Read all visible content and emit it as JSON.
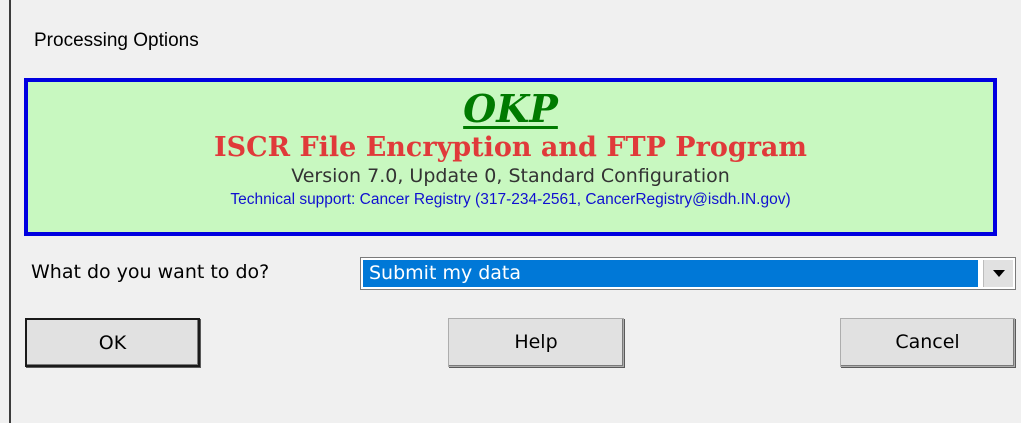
{
  "window": {
    "title": "Processing Options"
  },
  "banner": {
    "app_name": "OKP",
    "program_name": "ISCR File Encryption and FTP Program",
    "version": "Version 7.0, Update 0, Standard Configuration",
    "support": "Technical support: Cancer Registry (317-234-2561, CancerRegistry@isdh.IN.gov)"
  },
  "form": {
    "prompt": "What do you want to do?",
    "selected_option": "Submit my data"
  },
  "buttons": {
    "ok": "OK",
    "help": "Help",
    "cancel": "Cancel"
  },
  "colors": {
    "banner_bg": "#c8f8c0",
    "banner_border": "#0000e0",
    "app_name": "#007a00",
    "program_name": "#e03a3a",
    "support_text": "#1010d0",
    "selection_bg": "#0078d7"
  },
  "icons": {
    "dropdown": "chevron-down-icon"
  }
}
